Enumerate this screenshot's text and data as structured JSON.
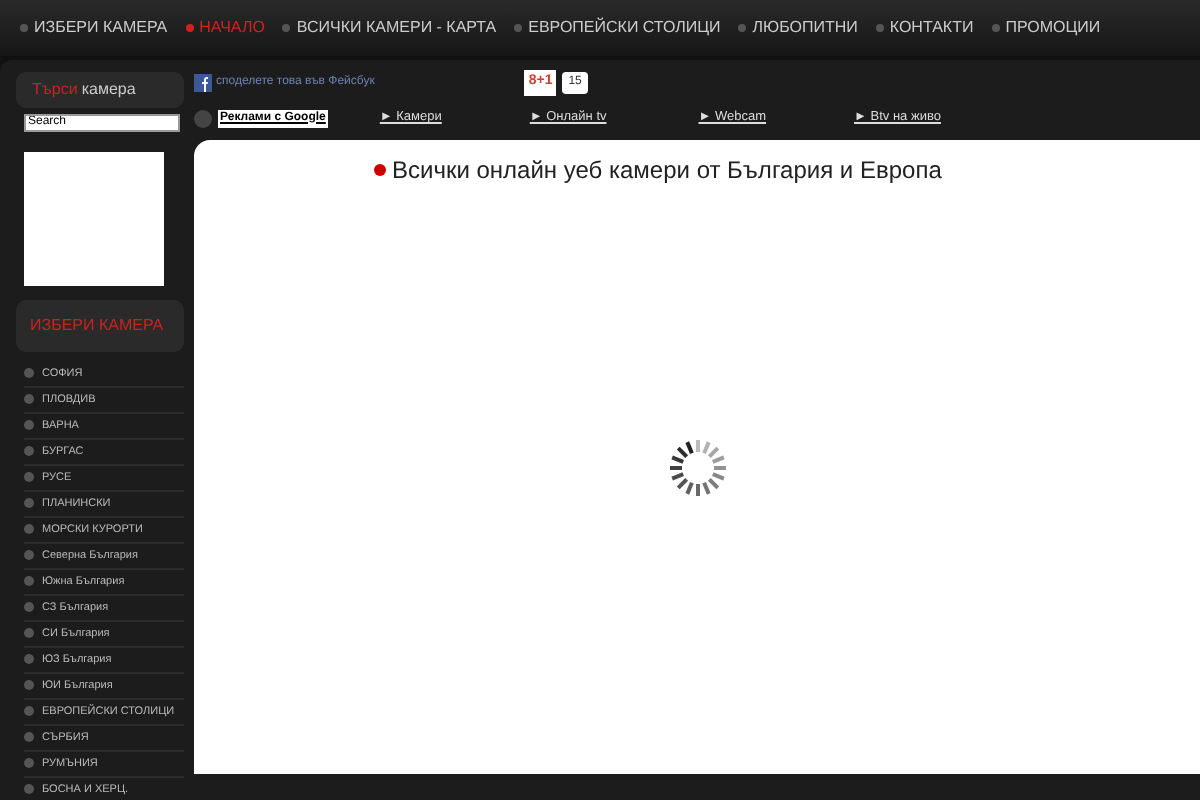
{
  "nav": [
    {
      "label": "ИЗБЕРИ КАМЕРА",
      "selected": false
    },
    {
      "label": "НАЧАЛО",
      "selected": true
    },
    {
      "label": "ВСИЧКИ КАМЕРИ - КАРТА",
      "selected": false
    },
    {
      "label": "ЕВРОПЕЙСКИ СТОЛИЦИ",
      "selected": false
    },
    {
      "label": "ЛЮБОПИТНИ",
      "selected": false
    },
    {
      "label": "КОНТАКТИ",
      "selected": false
    },
    {
      "label": "ПРОМОЦИИ",
      "selected": false
    }
  ],
  "sidebar": {
    "search_title": {
      "highlight": "Търси",
      "rest": "камера"
    },
    "search": {
      "value": "Search"
    },
    "menu_title": "ИЗБЕРИ КАМЕРА",
    "items": [
      "СОФИЯ",
      "ПЛОВДИВ",
      "ВАРНА",
      "БУРГАС",
      "РУСЕ",
      "ПЛАНИНСКИ",
      "МОРСКИ КУРОРТИ",
      "Северна България",
      "Южна България",
      "СЗ България",
      "СИ България",
      "ЮЗ България",
      "ЮИ България",
      "ЕВРОПЕЙСКИ СТОЛИЦИ",
      "СЪРБИЯ",
      "РУМЪНИЯ",
      "БОСНА И ХЕРЦ."
    ]
  },
  "share": {
    "text": "споделете това във Фейсбук",
    "plus_label": "8+1",
    "plus_count": "15"
  },
  "links": {
    "ads": "Реклами с Google",
    "items": [
      "► Камери",
      "► Онлайн tv",
      "► Webcam",
      "► Btv на живо"
    ]
  },
  "content": {
    "title": "Всички онлайн уеб камери от България и Европа"
  }
}
